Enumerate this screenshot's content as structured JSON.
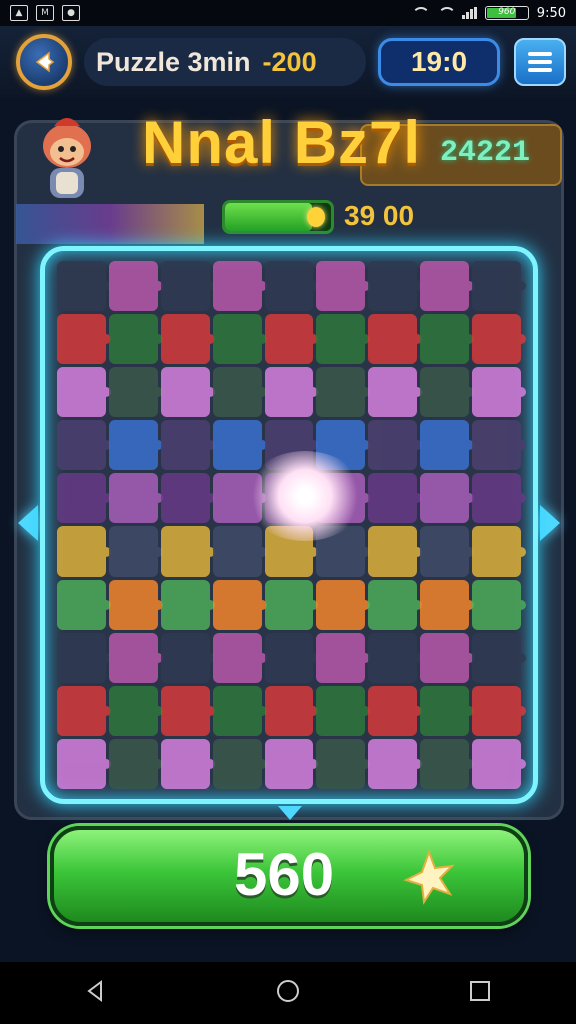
{
  "status_bar": {
    "left_icons": [
      "download-icon",
      "gallery-icon",
      "app-icon"
    ],
    "battery_text": "960",
    "time": "9:50"
  },
  "hud": {
    "title": "Puzzle 3min",
    "score": "-200",
    "timer": "19:0"
  },
  "banner": {
    "big_title": "Nnal Bz7l",
    "side_value": "24221"
  },
  "progress": {
    "fraction": 0.82,
    "coins": "39 00"
  },
  "main_button": {
    "value": "560"
  },
  "colors": {
    "frame_glow": "#7ef4ff",
    "button_green": "#3cc63a",
    "accent_gold": "#f3c43b"
  },
  "board": {
    "rows": 10,
    "cols": 9,
    "palette": [
      "#2f3a52",
      "#3e4a66",
      "#4a3f6e",
      "#2e7a3a",
      "#4fb35a",
      "#b060c0",
      "#e084e8",
      "#c05ab0",
      "#e8b83a",
      "#3a74d8",
      "#e03a3a",
      "#ff8a2a",
      "#6a3a8a",
      "#3a5a4a"
    ]
  }
}
